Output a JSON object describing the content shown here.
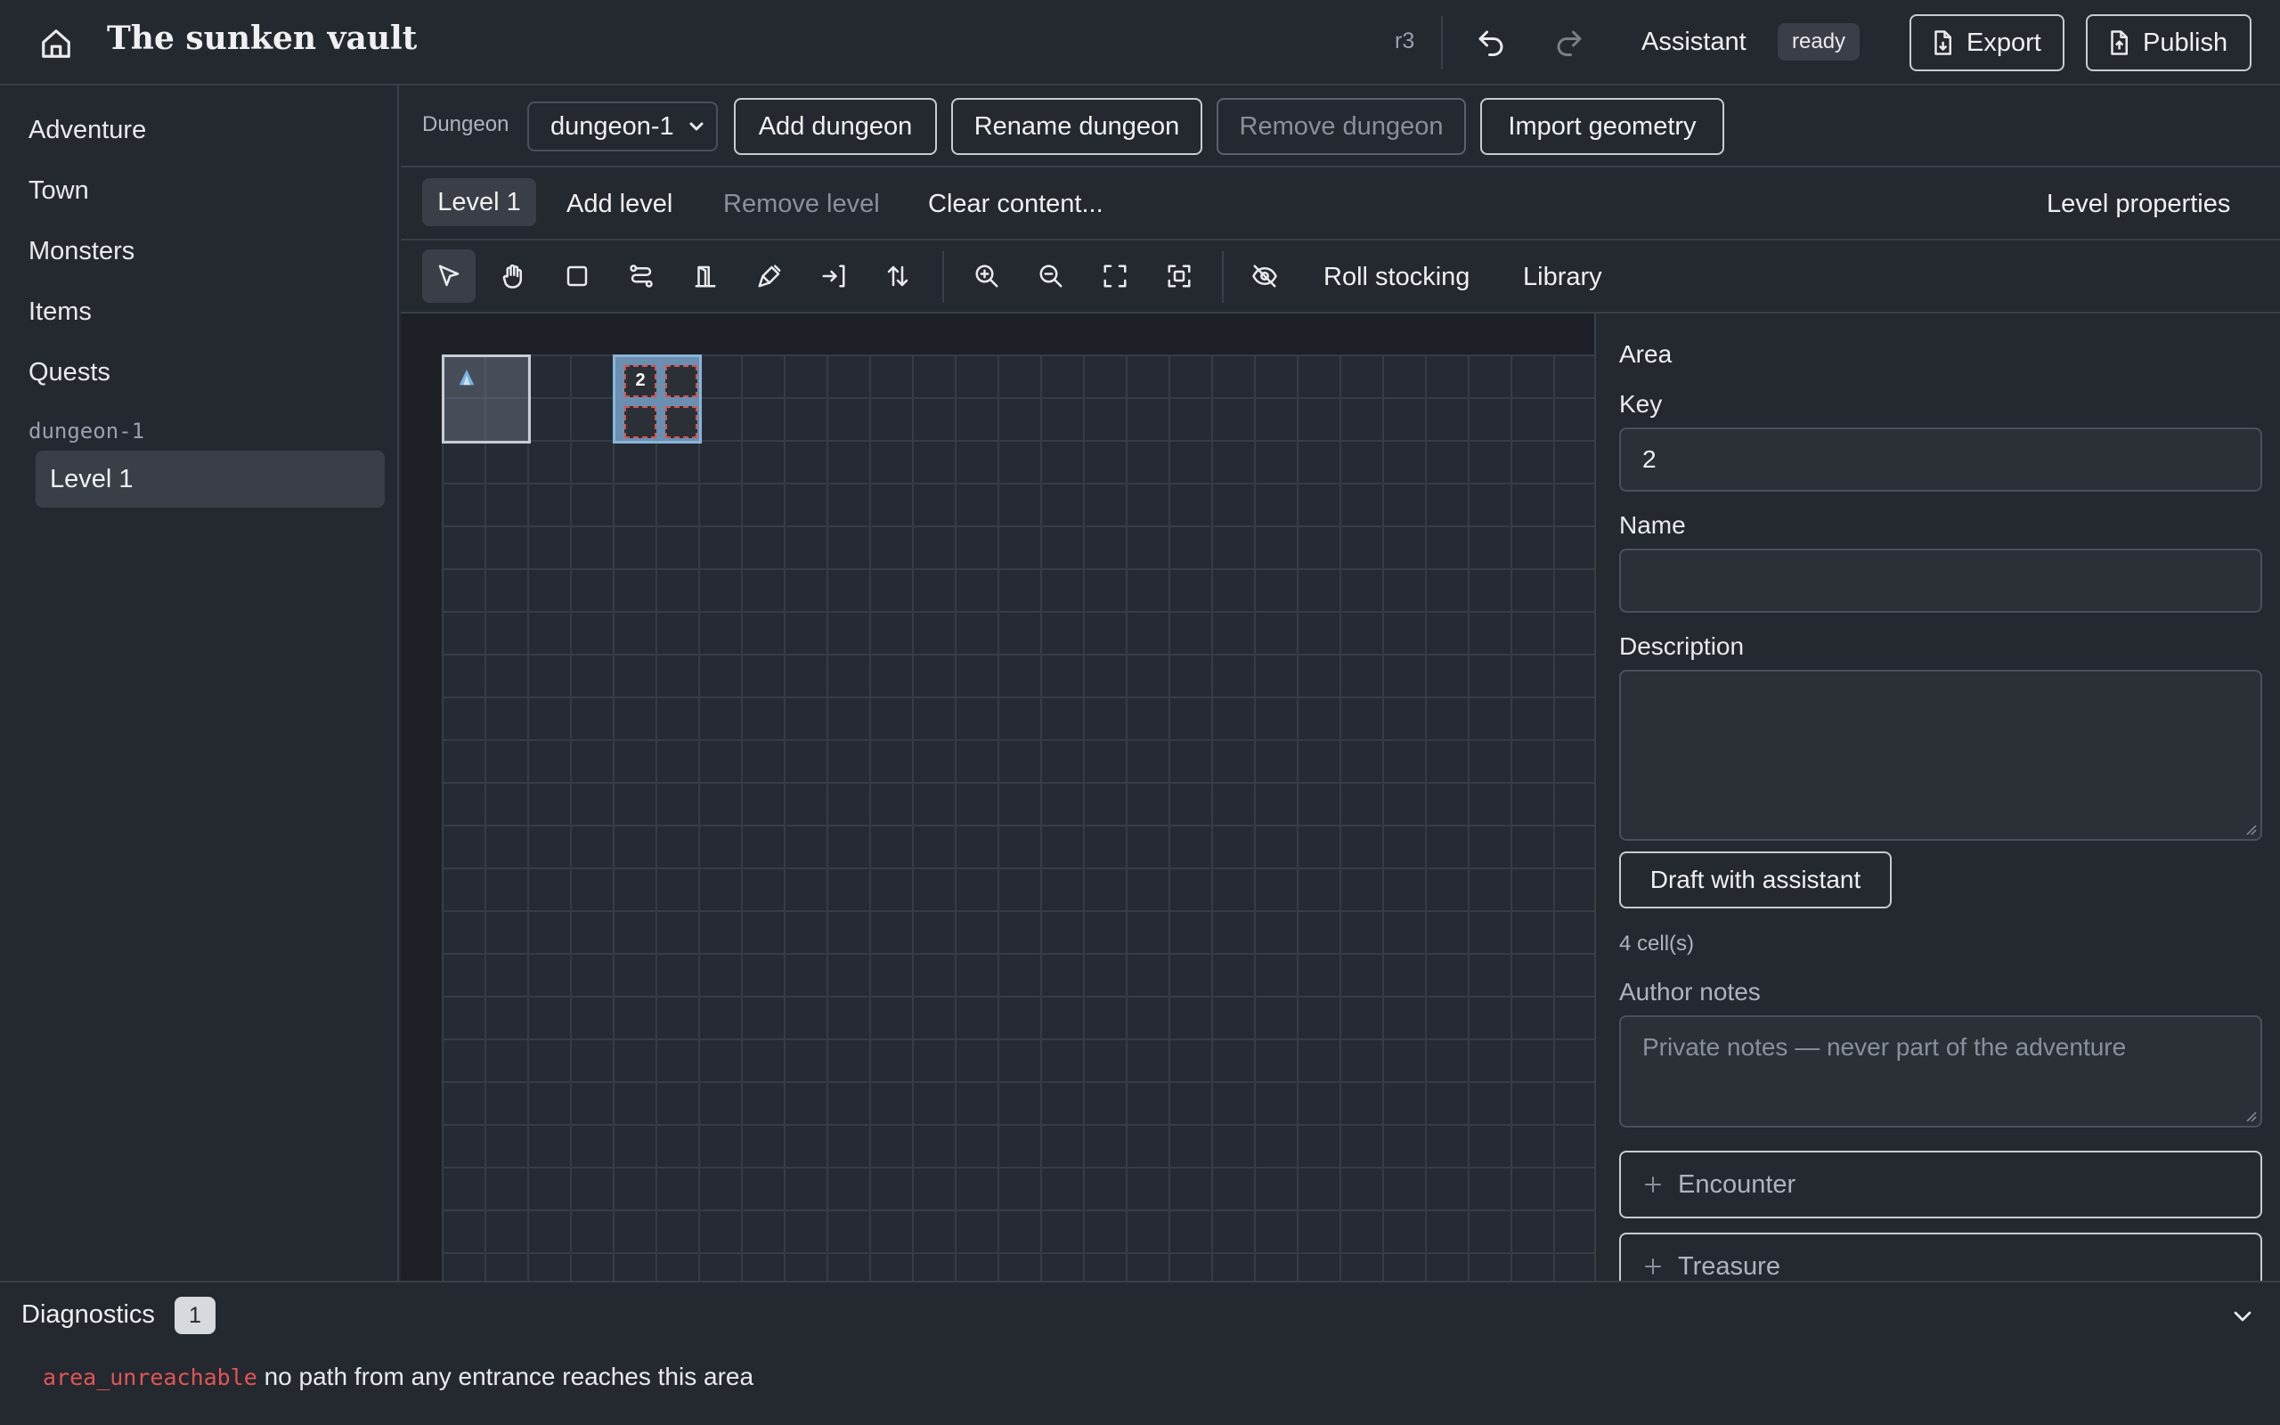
{
  "header": {
    "title": "The sunken vault",
    "revision": "r3",
    "assistant_label": "Assistant",
    "assistant_status": "ready",
    "export_label": "Export",
    "publish_label": "Publish",
    "icons": [
      "home-icon",
      "undo-icon",
      "redo-icon",
      "export-icon",
      "publish-icon"
    ]
  },
  "sidebar": {
    "items": [
      {
        "label": "Adventure"
      },
      {
        "label": "Town"
      },
      {
        "label": "Monsters"
      },
      {
        "label": "Items"
      },
      {
        "label": "Quests"
      }
    ],
    "group_label": "dungeon-1",
    "levels": [
      {
        "label": "Level 1",
        "selected": true
      }
    ]
  },
  "dungeon_bar": {
    "label": "Dungeon",
    "selected": "dungeon-1",
    "add_label": "Add dungeon",
    "rename_label": "Rename dungeon",
    "remove_label": "Remove dungeon",
    "import_label": "Import geometry"
  },
  "level_bar": {
    "active_tab": "Level 1",
    "add_label": "Add level",
    "remove_label": "Remove level",
    "clear_label": "Clear content...",
    "properties_label": "Level properties"
  },
  "toolbar": {
    "tools": [
      "select-icon",
      "pan-hand-icon",
      "room-rect-icon",
      "corridor-icon",
      "door-icon",
      "paint-brush-icon",
      "entrance-icon",
      "stairs-icon",
      "zoom-in-icon",
      "zoom-out-icon",
      "fit-icon",
      "focus-selection-icon",
      "hide-icon"
    ],
    "active_tool": "select-icon",
    "roll_label": "Roll stocking",
    "library_label": "Library"
  },
  "map": {
    "area_key": "2"
  },
  "inspector": {
    "title": "Area",
    "key_label": "Key",
    "key_value": "2",
    "name_label": "Name",
    "name_value": "",
    "description_label": "Description",
    "description_value": "",
    "draft_label": "Draft with assistant",
    "cell_count": "4 cell(s)",
    "notes_label": "Author notes",
    "notes_placeholder": "Private notes — never part of the adventure",
    "encounter_label": "Encounter",
    "treasure_label": "Treasure"
  },
  "diagnostics": {
    "title": "Diagnostics",
    "count": "1",
    "items": [
      {
        "code": "area_unreachable",
        "message": "no path from any entrance reaches this area"
      }
    ]
  },
  "colors": {
    "background": "#24282f",
    "canvas": "#1d2127",
    "selected_area": "#6b8fb0",
    "error": "#e05656"
  }
}
